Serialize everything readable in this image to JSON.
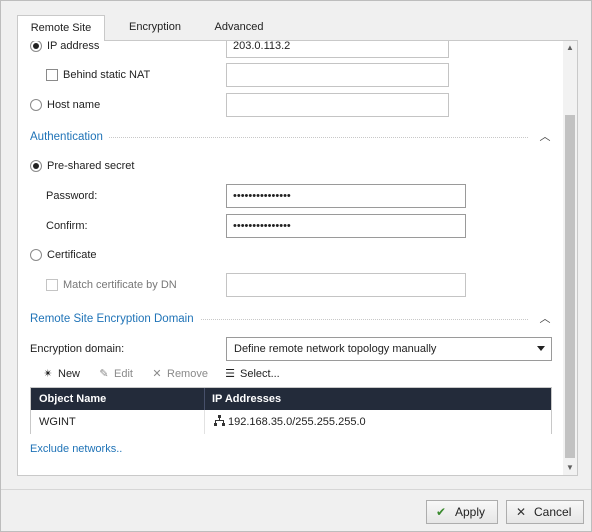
{
  "tabs": [
    {
      "label": "Remote Site",
      "active": true
    },
    {
      "label": "Encryption",
      "active": false
    },
    {
      "label": "Advanced",
      "active": false
    }
  ],
  "address": {
    "ip_option_label": "IP address",
    "ip_value": "203.0.113.2",
    "ip_selected": true,
    "static_nat_label": "Behind static NAT",
    "static_nat_value": "",
    "hostname_option_label": "Host name",
    "hostname_value": ""
  },
  "authentication": {
    "title": "Authentication",
    "psk_label": "Pre-shared secret",
    "psk_selected": true,
    "password_label": "Password:",
    "password_value": "•••••••••••••••",
    "confirm_label": "Confirm:",
    "confirm_value": "•••••••••••••••",
    "certificate_label": "Certificate",
    "match_dn_label": "Match certificate by DN",
    "match_dn_value": ""
  },
  "encryption_domain": {
    "title": "Remote Site Encryption Domain",
    "label": "Encryption domain:",
    "selected": "Define remote network topology manually",
    "toolbar": {
      "new_label": "New",
      "edit_label": "Edit",
      "remove_label": "Remove",
      "select_label": "Select..."
    },
    "table": {
      "columns": [
        "Object Name",
        "IP Addresses"
      ],
      "rows": [
        {
          "name": "WGINT",
          "ip": "192.168.35.0/255.255.255.0"
        }
      ]
    },
    "exclude_link": "Exclude networks.."
  },
  "footer": {
    "apply_label": "Apply",
    "cancel_label": "Cancel"
  },
  "colors": {
    "accent": "#1f73b7",
    "table_header": "#232b3a"
  },
  "icons": {
    "new": "sparkle-icon",
    "edit": "pencil-icon",
    "remove": "x-icon",
    "select": "list-select-icon",
    "network": "network-icon",
    "apply": "checkmark-icon",
    "cancel": "close-icon"
  }
}
